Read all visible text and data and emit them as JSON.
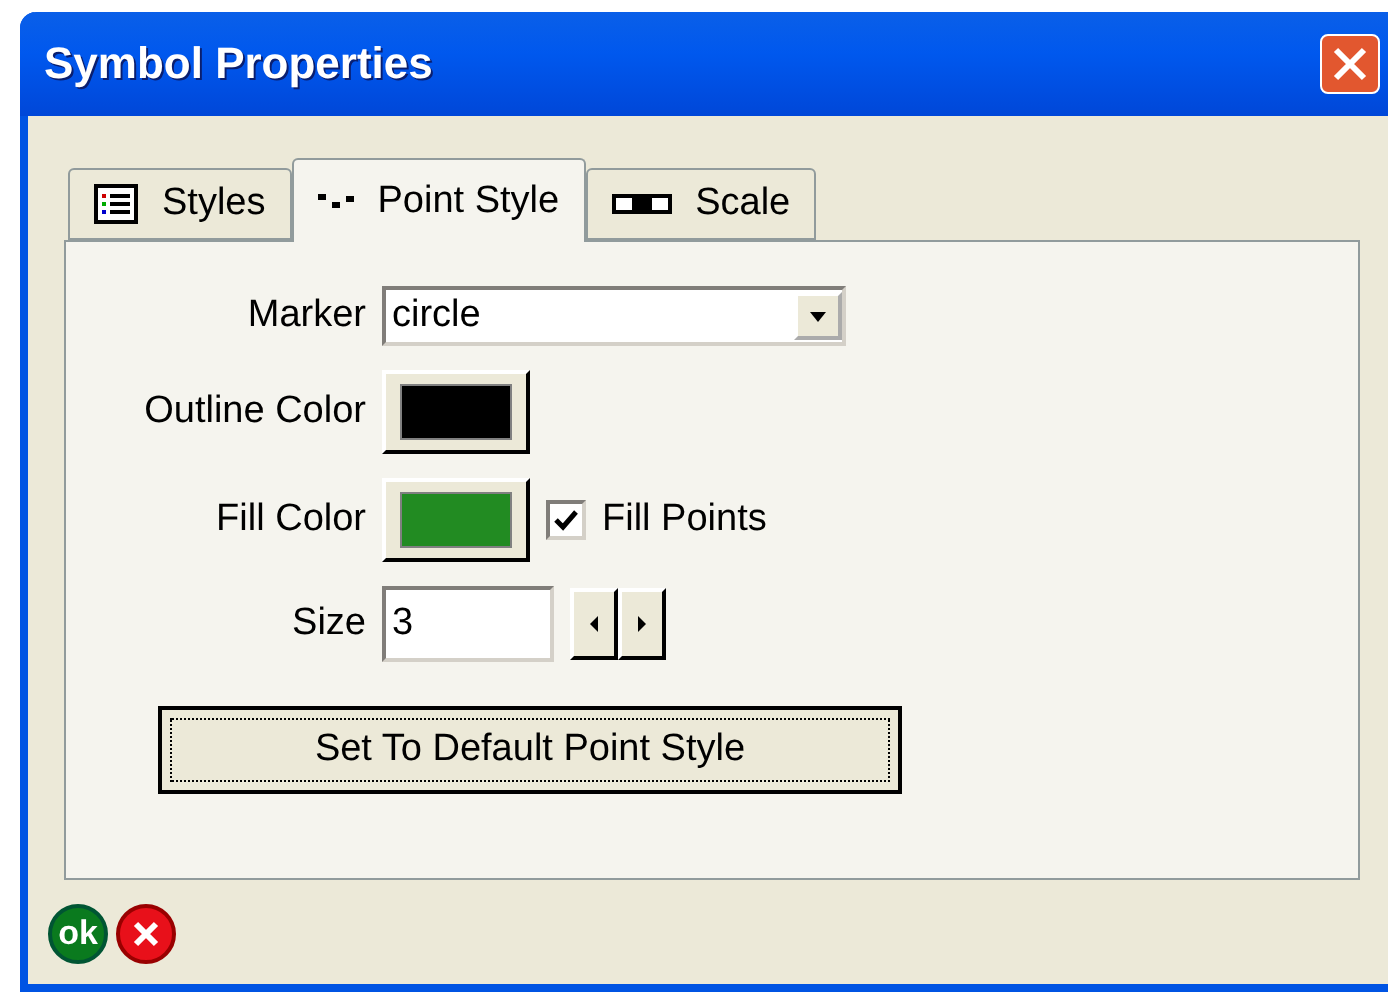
{
  "window": {
    "title": "Symbol Properties"
  },
  "tabs": [
    {
      "label": "Styles",
      "kind": "list",
      "selected": false
    },
    {
      "label": "Point Style",
      "kind": "points",
      "selected": true
    },
    {
      "label": "Scale",
      "kind": "scale",
      "selected": false
    }
  ],
  "marker": {
    "label": "Marker",
    "value": "circle"
  },
  "outline_color": {
    "label": "Outline Color",
    "color": "#000000"
  },
  "fill_color": {
    "label": "Fill Color",
    "color": "#228b22"
  },
  "fill_points": {
    "label": "Fill Points",
    "checked": true
  },
  "size": {
    "label": "Size",
    "value": "3"
  },
  "default_button": "Set To Default Point Style",
  "ok_button": "ok"
}
